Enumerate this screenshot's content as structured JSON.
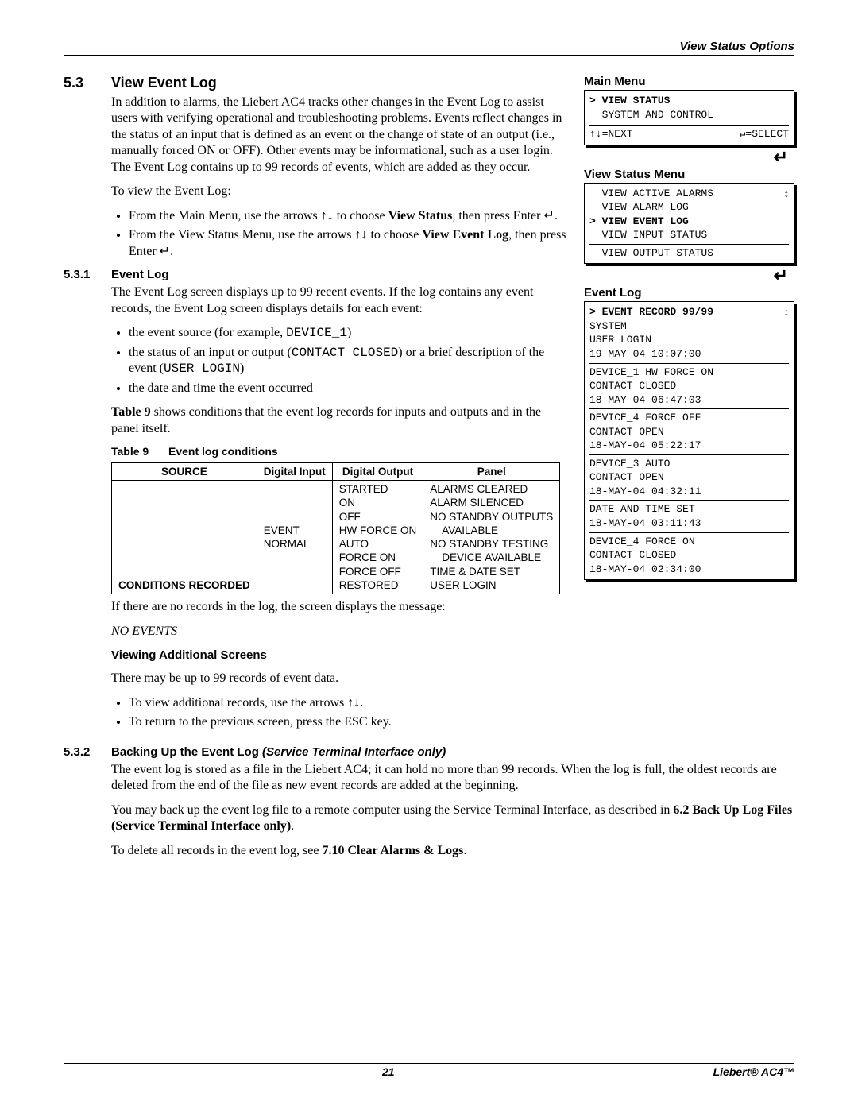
{
  "header": {
    "right": "View Status Options"
  },
  "sec53": {
    "num": "5.3",
    "title": "View Event Log",
    "p1": "In addition to alarms, the Liebert AC4 tracks other changes in the Event Log to assist users with verifying operational and troubleshooting problems. Events reflect changes in the status of an input that is defined as an event or the change of state of an output (i.e., manually forced ON or OFF). Other events may be informational, such as a user login. The Event Log contains up to 99 records of events, which are added as they occur.",
    "p2": "To view the Event Log:",
    "li1a": "From the Main Menu, use the arrows ",
    "li1b": " to choose ",
    "li1c": "View Status",
    "li1d": ", then press Enter ",
    "li2a": "From the View Status Menu, use the arrows ",
    "li2b": " to choose ",
    "li2c": "View Event Log",
    "li2d": ", then press Enter "
  },
  "sec531": {
    "num": "5.3.1",
    "title": "Event Log",
    "p1": "The Event Log screen displays up to 99 recent events. If the log contains any event records, the Event Log screen displays details for each event:",
    "li1a": "the event source (for example, ",
    "li1b": "DEVICE_1",
    "li1c": ")",
    "li2a": "the status of an input or output (",
    "li2b": "CONTACT CLOSED",
    "li2c": ") or a brief description of the event (",
    "li2d": "USER LOGIN",
    "li2e": ")",
    "li3": "the date and time the event occurred",
    "p2a": "Table 9",
    "p2b": " shows conditions that the event log records for inputs and outputs and in the panel itself.",
    "tblLabel": "Table 9",
    "tblCaption": "Event log conditions",
    "th1": "SOURCE",
    "th2": "Digital Input",
    "th3": "Digital Output",
    "th4": "Panel",
    "r1c1": "CONDITIONS RECORDED",
    "r1c2": "EVENT\nNORMAL",
    "r1c3": "STARTED\nON\nOFF\nHW FORCE ON\nAUTO\nFORCE ON\nFORCE OFF\nRESTORED",
    "r1c4": "ALARMS CLEARED\nALARM SILENCED\nNO STANDBY OUTPUTS\n    AVAILABLE\nNO STANDBY TESTING\n    DEVICE AVAILABLE\nTIME & DATE SET\nUSER LOGIN",
    "p3": "If there are no records in the log, the screen displays the message:",
    "noevents": "NO EVENTS",
    "vasTitle": "Viewing Additional Screens",
    "vasP": "There may be up to 99 records of event data.",
    "vasLi1a": "To view additional records, use the arrows ",
    "vasLi2": "To return to the previous screen, press the ESC key."
  },
  "sec532": {
    "num": "5.3.2",
    "title_a": "Backing Up the Event Log ",
    "title_b": "(Service Terminal Interface only)",
    "p1": "The event log is stored as a file in the Liebert AC4; it can hold no more than 99 records. When the log is full, the oldest records are deleted from the end of the file as new event records are added at the beginning.",
    "p2a": "You may back up the event log file to a remote computer using the Service Terminal Interface, as described in ",
    "p2b": "6.2 Back Up Log Files (Service Terminal Interface only)",
    "p2c": ".",
    "p3a": "To delete all records in the event log, see ",
    "p3b": "7.10 Clear Alarms & Logs",
    "p3c": "."
  },
  "lcd": {
    "mainTitle": "Main Menu",
    "main_sel": "> VIEW STATUS",
    "main_l2": "  SYSTEM AND CONTROL",
    "main_foot_l": "↑↓=NEXT",
    "main_foot_r": "↵=SELECT",
    "vsTitle": "View Status Menu",
    "vs_l1": "  VIEW ACTIVE ALARMS",
    "vs_l2": "  VIEW ALARM LOG",
    "vs_sel": "> VIEW EVENT LOG",
    "vs_l4": "  VIEW INPUT STATUS",
    "vs_l5": "  VIEW OUTPUT STATUS",
    "elTitle": "Event Log",
    "el_sel": "> EVENT RECORD 99/99",
    "el_b1_l1": "SYSTEM",
    "el_b1_l2": "USER LOGIN",
    "el_b1_l3": "19-MAY-04 10:07:00",
    "el_b2_l1": "DEVICE_1 HW FORCE ON",
    "el_b2_l2": "CONTACT CLOSED",
    "el_b2_l3": "18-MAY-04 06:47:03",
    "el_b3_l1": "DEVICE_4 FORCE OFF",
    "el_b3_l2": "CONTACT OPEN",
    "el_b3_l3": "18-MAY-04 05:22:17",
    "el_b4_l1": "DEVICE_3 AUTO",
    "el_b4_l2": "CONTACT OPEN",
    "el_b4_l3": "18-MAY-04 04:32:11",
    "el_b5_l1": "DATE AND TIME SET",
    "el_b5_l2": "18-MAY-04 03:11:43",
    "el_b6_l1": "DEVICE_4 FORCE ON",
    "el_b6_l2": "CONTACT CLOSED",
    "el_b6_l3": "18-MAY-04 02:34:00"
  },
  "glyphs": {
    "updown": "↑↓",
    "enter": "↵",
    "updownArrow": "↕"
  },
  "footer": {
    "page": "21",
    "product": "Liebert® AC4™"
  }
}
